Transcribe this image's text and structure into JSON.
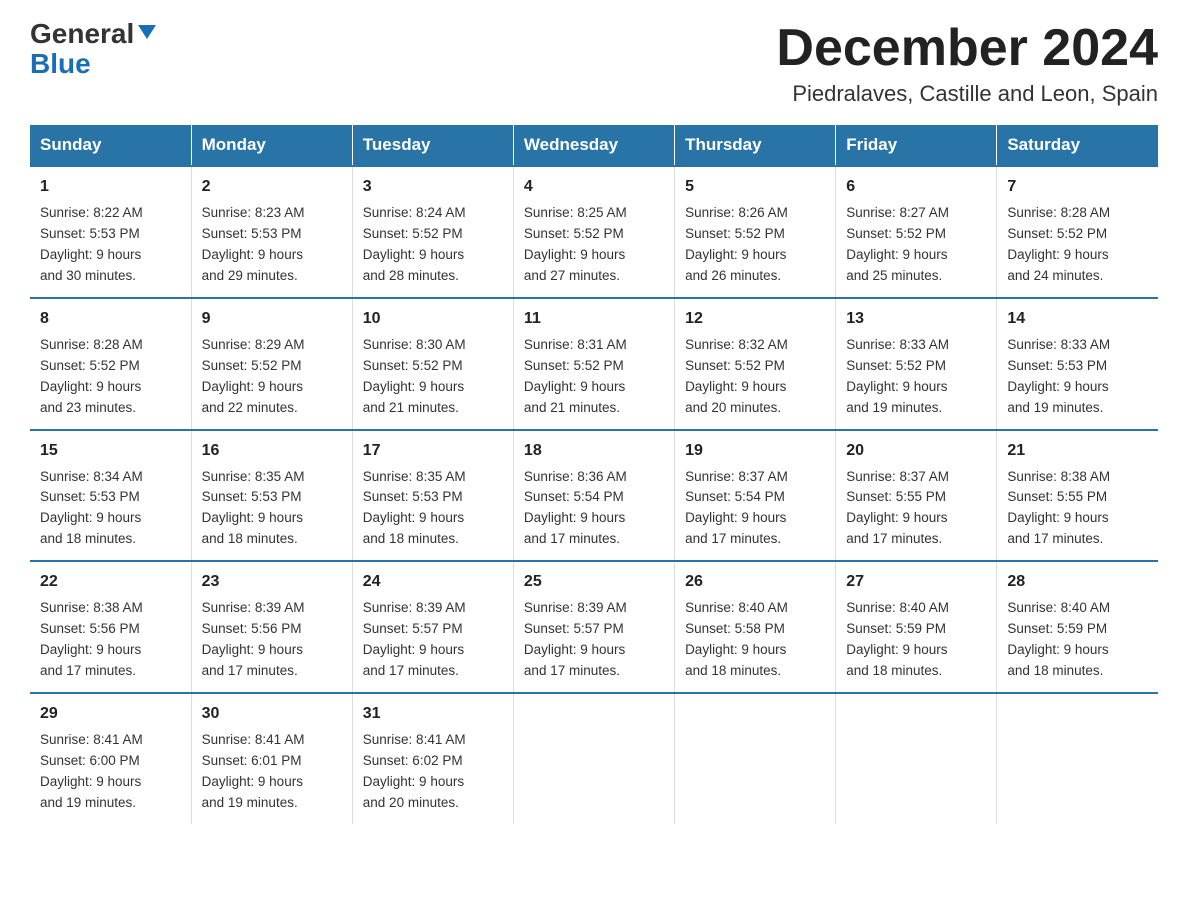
{
  "header": {
    "logo_line1": "General",
    "logo_line2": "Blue",
    "title": "December 2024",
    "subtitle": "Piedralaves, Castille and Leon, Spain"
  },
  "days_of_week": [
    "Sunday",
    "Monday",
    "Tuesday",
    "Wednesday",
    "Thursday",
    "Friday",
    "Saturday"
  ],
  "weeks": [
    [
      {
        "num": "1",
        "sunrise": "8:22 AM",
        "sunset": "5:53 PM",
        "daylight": "9 hours and 30 minutes."
      },
      {
        "num": "2",
        "sunrise": "8:23 AM",
        "sunset": "5:53 PM",
        "daylight": "9 hours and 29 minutes."
      },
      {
        "num": "3",
        "sunrise": "8:24 AM",
        "sunset": "5:52 PM",
        "daylight": "9 hours and 28 minutes."
      },
      {
        "num": "4",
        "sunrise": "8:25 AM",
        "sunset": "5:52 PM",
        "daylight": "9 hours and 27 minutes."
      },
      {
        "num": "5",
        "sunrise": "8:26 AM",
        "sunset": "5:52 PM",
        "daylight": "9 hours and 26 minutes."
      },
      {
        "num": "6",
        "sunrise": "8:27 AM",
        "sunset": "5:52 PM",
        "daylight": "9 hours and 25 minutes."
      },
      {
        "num": "7",
        "sunrise": "8:28 AM",
        "sunset": "5:52 PM",
        "daylight": "9 hours and 24 minutes."
      }
    ],
    [
      {
        "num": "8",
        "sunrise": "8:28 AM",
        "sunset": "5:52 PM",
        "daylight": "9 hours and 23 minutes."
      },
      {
        "num": "9",
        "sunrise": "8:29 AM",
        "sunset": "5:52 PM",
        "daylight": "9 hours and 22 minutes."
      },
      {
        "num": "10",
        "sunrise": "8:30 AM",
        "sunset": "5:52 PM",
        "daylight": "9 hours and 21 minutes."
      },
      {
        "num": "11",
        "sunrise": "8:31 AM",
        "sunset": "5:52 PM",
        "daylight": "9 hours and 21 minutes."
      },
      {
        "num": "12",
        "sunrise": "8:32 AM",
        "sunset": "5:52 PM",
        "daylight": "9 hours and 20 minutes."
      },
      {
        "num": "13",
        "sunrise": "8:33 AM",
        "sunset": "5:52 PM",
        "daylight": "9 hours and 19 minutes."
      },
      {
        "num": "14",
        "sunrise": "8:33 AM",
        "sunset": "5:53 PM",
        "daylight": "9 hours and 19 minutes."
      }
    ],
    [
      {
        "num": "15",
        "sunrise": "8:34 AM",
        "sunset": "5:53 PM",
        "daylight": "9 hours and 18 minutes."
      },
      {
        "num": "16",
        "sunrise": "8:35 AM",
        "sunset": "5:53 PM",
        "daylight": "9 hours and 18 minutes."
      },
      {
        "num": "17",
        "sunrise": "8:35 AM",
        "sunset": "5:53 PM",
        "daylight": "9 hours and 18 minutes."
      },
      {
        "num": "18",
        "sunrise": "8:36 AM",
        "sunset": "5:54 PM",
        "daylight": "9 hours and 17 minutes."
      },
      {
        "num": "19",
        "sunrise": "8:37 AM",
        "sunset": "5:54 PM",
        "daylight": "9 hours and 17 minutes."
      },
      {
        "num": "20",
        "sunrise": "8:37 AM",
        "sunset": "5:55 PM",
        "daylight": "9 hours and 17 minutes."
      },
      {
        "num": "21",
        "sunrise": "8:38 AM",
        "sunset": "5:55 PM",
        "daylight": "9 hours and 17 minutes."
      }
    ],
    [
      {
        "num": "22",
        "sunrise": "8:38 AM",
        "sunset": "5:56 PM",
        "daylight": "9 hours and 17 minutes."
      },
      {
        "num": "23",
        "sunrise": "8:39 AM",
        "sunset": "5:56 PM",
        "daylight": "9 hours and 17 minutes."
      },
      {
        "num": "24",
        "sunrise": "8:39 AM",
        "sunset": "5:57 PM",
        "daylight": "9 hours and 17 minutes."
      },
      {
        "num": "25",
        "sunrise": "8:39 AM",
        "sunset": "5:57 PM",
        "daylight": "9 hours and 17 minutes."
      },
      {
        "num": "26",
        "sunrise": "8:40 AM",
        "sunset": "5:58 PM",
        "daylight": "9 hours and 18 minutes."
      },
      {
        "num": "27",
        "sunrise": "8:40 AM",
        "sunset": "5:59 PM",
        "daylight": "9 hours and 18 minutes."
      },
      {
        "num": "28",
        "sunrise": "8:40 AM",
        "sunset": "5:59 PM",
        "daylight": "9 hours and 18 minutes."
      }
    ],
    [
      {
        "num": "29",
        "sunrise": "8:41 AM",
        "sunset": "6:00 PM",
        "daylight": "9 hours and 19 minutes."
      },
      {
        "num": "30",
        "sunrise": "8:41 AM",
        "sunset": "6:01 PM",
        "daylight": "9 hours and 19 minutes."
      },
      {
        "num": "31",
        "sunrise": "8:41 AM",
        "sunset": "6:02 PM",
        "daylight": "9 hours and 20 minutes."
      },
      null,
      null,
      null,
      null
    ]
  ]
}
